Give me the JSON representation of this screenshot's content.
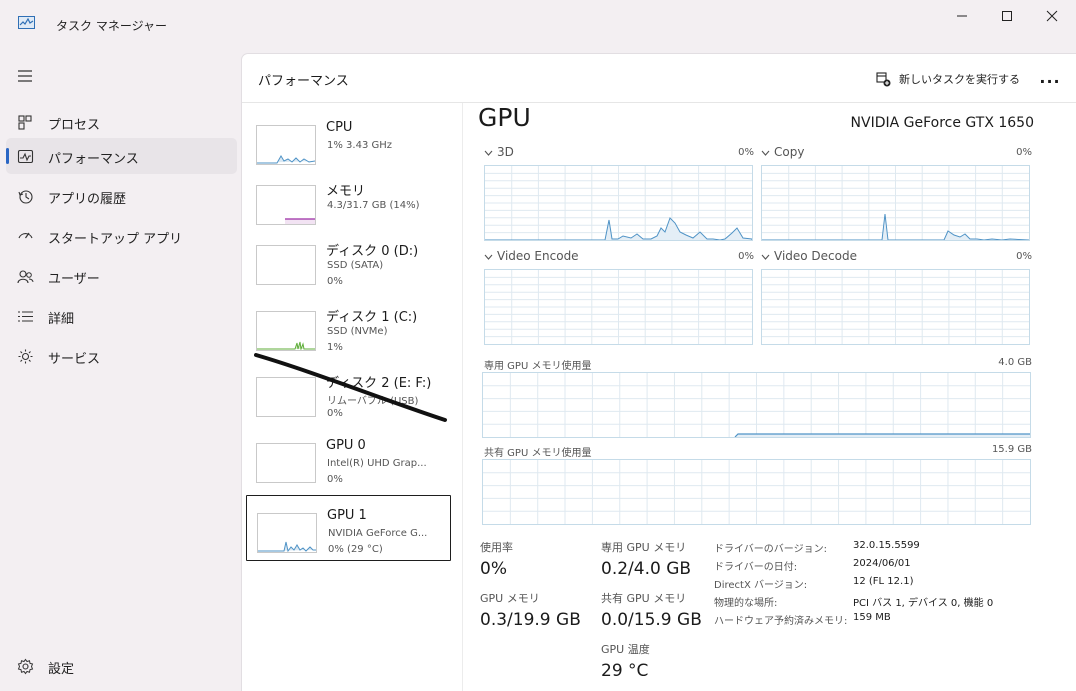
{
  "app": {
    "title": "タスク マネージャー",
    "icon": "task-manager-icon",
    "window_controls": [
      "minimize",
      "maximize",
      "close"
    ]
  },
  "nav": {
    "items": [
      {
        "label": "プロセス",
        "icon": "processes-icon",
        "active": false
      },
      {
        "label": "パフォーマンス",
        "icon": "performance-icon",
        "active": true
      },
      {
        "label": "アプリの履歴",
        "icon": "history-icon",
        "active": false
      },
      {
        "label": "スタートアップ アプリ",
        "icon": "startup-icon",
        "active": false
      },
      {
        "label": "ユーザー",
        "icon": "users-icon",
        "active": false
      },
      {
        "label": "詳細",
        "icon": "details-icon",
        "active": false
      },
      {
        "label": "サービス",
        "icon": "services-icon",
        "active": false
      }
    ],
    "settings": {
      "label": "設定",
      "icon": "settings-icon"
    }
  },
  "header": {
    "title": "パフォーマンス",
    "run_task": "新しいタスクを実行する",
    "more": "..."
  },
  "devices": [
    {
      "name": "CPU",
      "sub1": "1%  3.43 GHz",
      "sub2": ""
    },
    {
      "name": "メモリ",
      "sub1": "4.3/31.7 GB (14%)",
      "sub2": ""
    },
    {
      "name": "ディスク 0 (D:)",
      "sub1": "SSD (SATA)",
      "sub2": "0%"
    },
    {
      "name": "ディスク 1 (C:)",
      "sub1": "SSD (NVMe)",
      "sub2": "1%"
    },
    {
      "name": "ディスク 2 (E: F:)",
      "sub1": "リムーバブル (USB)",
      "sub2": "0%"
    },
    {
      "name": "GPU 0",
      "sub1": "Intel(R) UHD Grap...",
      "sub2": "0%"
    },
    {
      "name": "GPU 1",
      "sub1": "NVIDIA GeForce G...",
      "sub2": "0%  (29 °C)"
    }
  ],
  "gpu": {
    "title": "GPU",
    "model": "NVIDIA GeForce GTX 1650",
    "engines": [
      {
        "name": "3D",
        "percent": "0%"
      },
      {
        "name": "Copy",
        "percent": "0%"
      },
      {
        "name": "Video Encode",
        "percent": "0%"
      },
      {
        "name": "Video Decode",
        "percent": "0%"
      }
    ],
    "dedicated": {
      "label": "専用 GPU メモリ使用量",
      "capacity": "4.0 GB"
    },
    "shared": {
      "label": "共有 GPU メモリ使用量",
      "capacity": "15.9 GB"
    },
    "stats": {
      "utilization_label": "使用率",
      "utilization": "0%",
      "dedicated_label": "専用 GPU メモリ",
      "dedicated": "0.2/4.0 GB",
      "gpu_mem_label": "GPU メモリ",
      "gpu_mem": "0.3/19.9 GB",
      "shared_label": "共有 GPU メモリ",
      "shared": "0.0/15.9 GB",
      "temp_label": "GPU 温度",
      "temp": "29 °C"
    },
    "info": [
      {
        "key": "ドライバーのバージョン:",
        "value": "32.0.15.5599"
      },
      {
        "key": "ドライバーの日付:",
        "value": "2024/06/01"
      },
      {
        "key": "DirectX バージョン:",
        "value": "12 (FL 12.1)"
      },
      {
        "key": "物理的な場所:",
        "value": "PCI バス 1, デバイス 0, 機能 0"
      },
      {
        "key": "ハードウェア予約済みメモリ:",
        "value": "159 MB"
      }
    ]
  },
  "colors": {
    "accent": "#2a66c4",
    "graph_line": "#4f93c6",
    "graph_grid": "#dfe9f0",
    "memory_line": "#9b2aa5",
    "disk_line": "#5fae3a"
  }
}
